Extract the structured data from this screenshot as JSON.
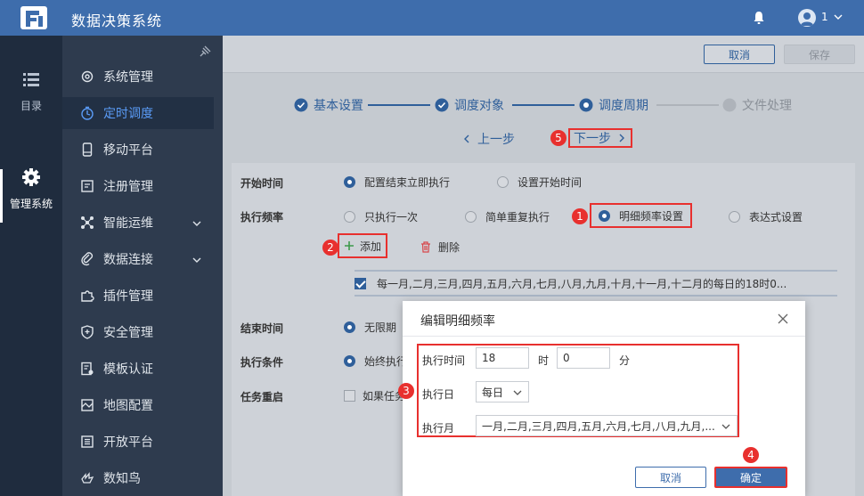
{
  "app": {
    "title": "数据决策系统",
    "user": "1"
  },
  "rail": [
    {
      "label": "目录",
      "icon": "list-icon"
    },
    {
      "label": "管理系统",
      "icon": "gear-icon"
    }
  ],
  "sidebar": {
    "items": [
      {
        "label": "系统管理",
        "icon": "settings-icon"
      },
      {
        "label": "定时调度",
        "icon": "timer-icon"
      },
      {
        "label": "移动平台",
        "icon": "mobile-icon"
      },
      {
        "label": "注册管理",
        "icon": "register-icon"
      },
      {
        "label": "智能运维",
        "icon": "ops-icon"
      },
      {
        "label": "数据连接",
        "icon": "link-icon"
      },
      {
        "label": "插件管理",
        "icon": "plugin-icon"
      },
      {
        "label": "安全管理",
        "icon": "shield-icon"
      },
      {
        "label": "模板认证",
        "icon": "template-icon"
      },
      {
        "label": "地图配置",
        "icon": "map-icon"
      },
      {
        "label": "开放平台",
        "icon": "open-platform-icon"
      },
      {
        "label": "数知鸟",
        "icon": "bird-icon"
      }
    ]
  },
  "toolbar": {
    "cancel": "取消",
    "save": "保存"
  },
  "steps": [
    "基本设置",
    "调度对象",
    "调度周期",
    "文件处理"
  ],
  "nav": {
    "prev": "上一步",
    "next": "下一步"
  },
  "form": {
    "start_label": "开始时间",
    "start_opt1": "配置结束立即执行",
    "start_opt2": "设置开始时间",
    "freq_label": "执行频率",
    "freq_opt1": "只执行一次",
    "freq_opt2": "简单重复执行",
    "freq_opt3": "明细频率设置",
    "freq_opt4": "表达式设置",
    "add": "添加",
    "delete": "删除",
    "rule_text": "每一月,二月,三月,四月,五月,六月,七月,八月,九月,十月,十一月,十二月的每日的18时0...",
    "end_label": "结束时间",
    "end_opt1": "无限期",
    "cond_label": "执行条件",
    "cond_opt1": "始终执行",
    "restart_label": "任务重启",
    "restart_opt1": "如果任务"
  },
  "badges": [
    "1",
    "2",
    "3",
    "4",
    "5"
  ],
  "dialog": {
    "title": "编辑明细频率",
    "time_label": "执行时间",
    "hour_value": "18",
    "hour_unit": "时",
    "minute_value": "0",
    "minute_unit": "分",
    "day_label": "执行日",
    "day_value": "每日",
    "month_label": "执行月",
    "month_value": "一月,二月,三月,四月,五月,六月,七月,八月,九月,...",
    "cancel": "取消",
    "confirm": "确定"
  }
}
